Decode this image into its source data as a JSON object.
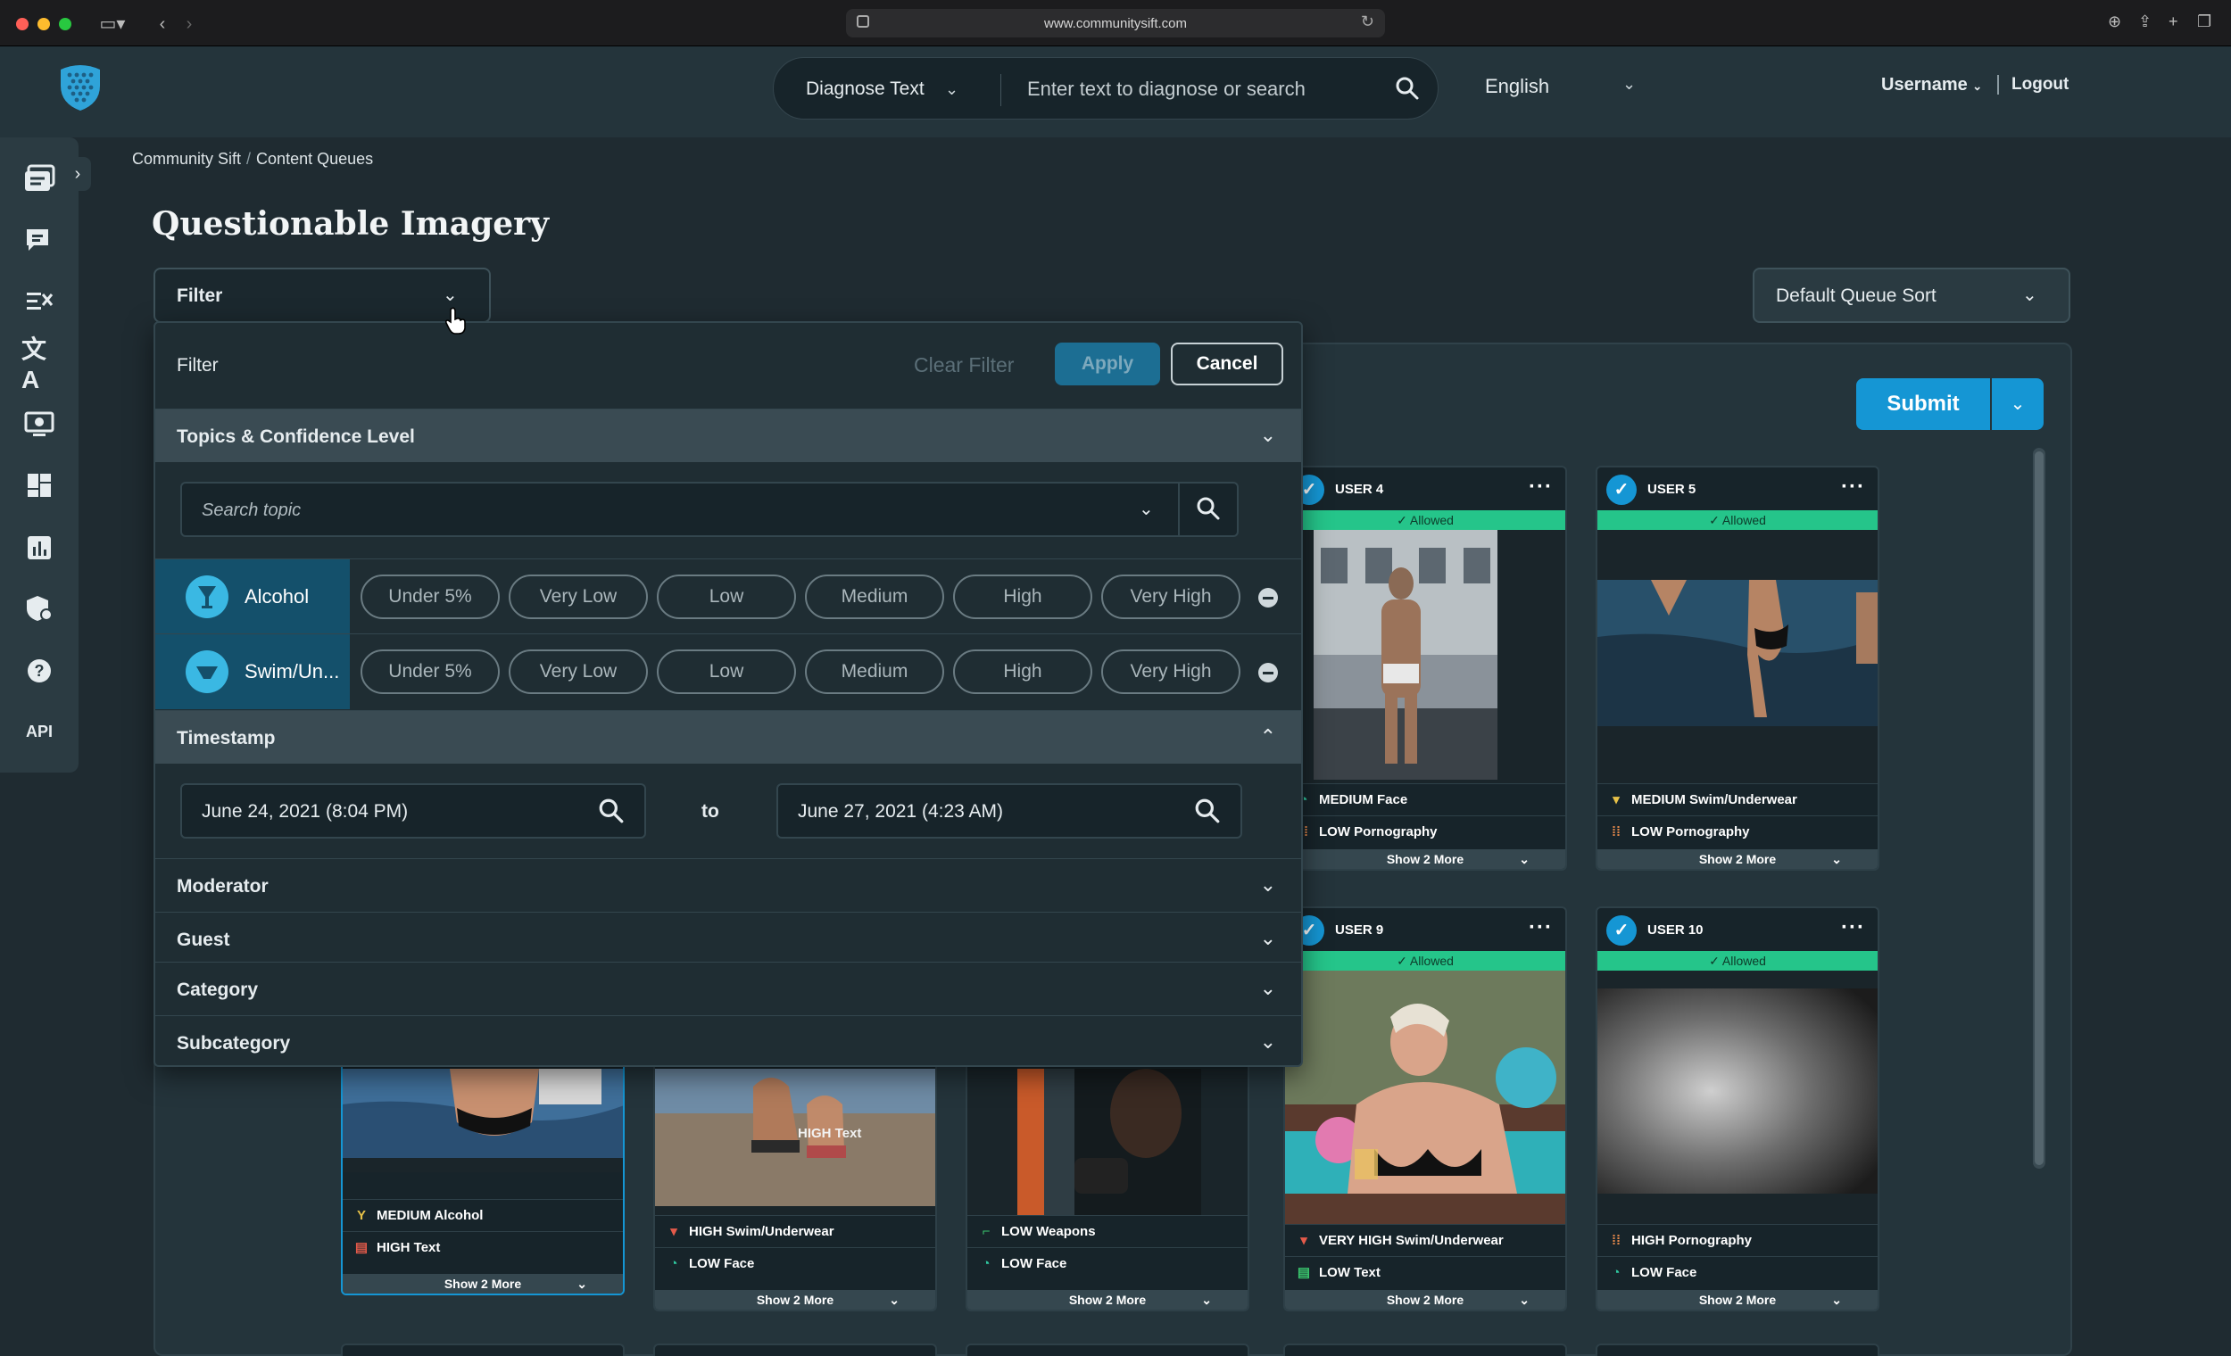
{
  "browser": {
    "url": "www.communitysift.com"
  },
  "header": {
    "diagnose_select": "Diagnose Text",
    "search_placeholder": "Enter text to diagnose or search",
    "language": "English",
    "username": "Username",
    "logout": "Logout"
  },
  "sidebar": {
    "items": [
      "queues-icon",
      "chat-icon",
      "rules-icon",
      "translate-icon",
      "monitor-icon",
      "dashboard-icon",
      "reports-icon",
      "security-icon",
      "help-icon",
      "API"
    ]
  },
  "breadcrumb": {
    "root": "Community Sift",
    "current": "Content Queues"
  },
  "page": {
    "title": "Questionable Imagery",
    "filter_label": "Filter",
    "sort_label": "Default Queue Sort",
    "submit": "Submit"
  },
  "filter_panel": {
    "title": "Filter",
    "clear": "Clear Filter",
    "apply": "Apply",
    "cancel": "Cancel",
    "sections": {
      "topics": "Topics & Confidence Level",
      "timestamp": "Timestamp",
      "moderator": "Moderator",
      "guest": "Guest",
      "category": "Category",
      "subcategory": "Subcategory"
    },
    "topic_search_placeholder": "Search topic",
    "confidence_levels": [
      "Under 5%",
      "Very Low",
      "Low",
      "Medium",
      "High",
      "Very High"
    ],
    "topics": [
      {
        "name": "Alcohol"
      },
      {
        "name": "Swim/Un..."
      }
    ],
    "timestamp_from": "June 24, 2021 (8:04 PM)",
    "timestamp_to_label": "to",
    "timestamp_to": "June 27, 2021 (4:23 AM)"
  },
  "cards": [
    {
      "user": "USER 4",
      "status": "✓ Allowed",
      "rows": [
        "MEDIUM Face",
        "LOW Pornography"
      ],
      "more": "Show 2 More",
      "colors": [
        "#b9c0c4",
        "#6d5a48"
      ]
    },
    {
      "user": "USER 5",
      "status": "✓ Allowed",
      "rows": [
        "MEDIUM Swim/Underwear",
        "LOW Pornography"
      ],
      "more": "Show 2 More",
      "colors": [
        "#28506a",
        "#1c3446"
      ]
    },
    {
      "user": "USER 9",
      "status": "✓ Allowed",
      "rows": [
        "VERY HIGH Swim/Underwear",
        "LOW Text"
      ],
      "more": "Show 2 More",
      "colors": [
        "#5a7a52",
        "#c98a6a"
      ]
    },
    {
      "user": "USER 10",
      "status": "✓ Allowed",
      "rows": [
        "HIGH Pornography",
        "LOW Face"
      ],
      "more": "Show 2 More",
      "colors": [
        "#6e6e6e",
        "#2a2a2a"
      ]
    },
    {
      "user": "",
      "status": "",
      "rows": [
        "MEDIUM Alcohol",
        "HIGH Text"
      ],
      "more": "Show 2 More",
      "colors": [
        "#3f6f9a",
        "#2a4f73"
      ]
    },
    {
      "user": "",
      "status": "",
      "rows": [
        "HIGH Swim/Underwear",
        "LOW Face"
      ],
      "more": "Show 2 More",
      "colors": [
        "#5f7c94",
        "#8a7a68"
      ]
    },
    {
      "user": "",
      "status": "",
      "rows": [
        "LOW Weapons",
        "LOW Face"
      ],
      "more": "Show 2 More",
      "colors": [
        "#2f3d44",
        "#141b1e"
      ]
    }
  ],
  "overlay_text": "HIGH Text",
  "colors": {
    "accent": "#1596d4",
    "allowed": "#25c58a",
    "topic_tag": "#14506b"
  }
}
